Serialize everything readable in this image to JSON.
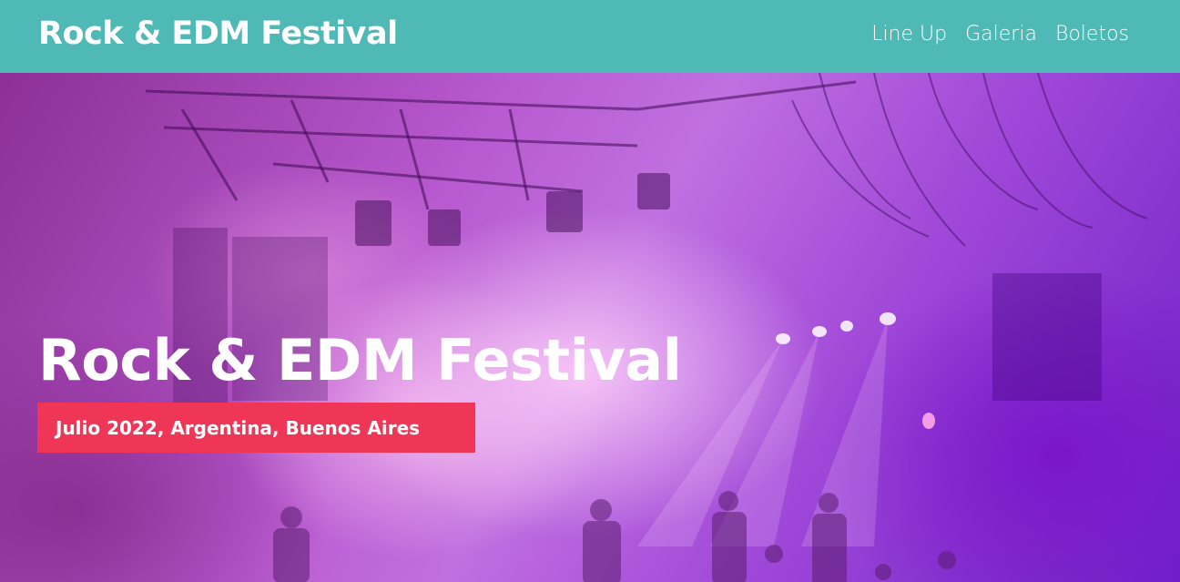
{
  "header": {
    "brand": "Rock & EDM Festival",
    "nav": [
      {
        "label": "Line Up"
      },
      {
        "label": "Galeria"
      },
      {
        "label": "Boletos"
      }
    ],
    "background_color": "#4fb9b5"
  },
  "hero": {
    "title": "Rock & EDM Festival",
    "subtitle": "Julio 2022, Argentina, Buenos Aires",
    "badge_color": "#f03656",
    "image_description_colors": [
      "#8d2f96",
      "#c070e0",
      "#6e20c8"
    ]
  }
}
